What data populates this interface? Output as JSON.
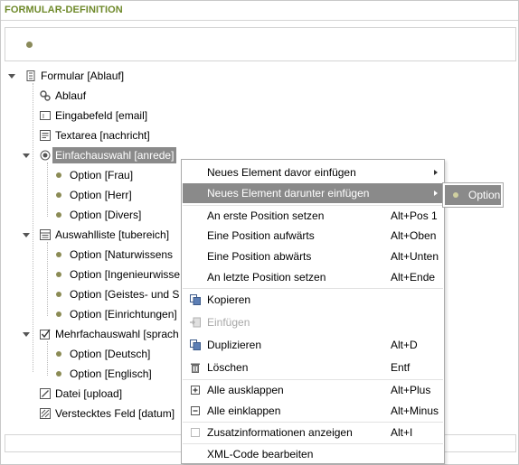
{
  "panel": {
    "title": "FORMULAR-DEFINITION"
  },
  "tree": {
    "root": "Formular [Ablauf]",
    "ablauf": "Ablauf",
    "eingabefeld": "Eingabefeld [email]",
    "textarea": "Textarea [nachricht]",
    "einfachauswahl": "Einfachauswahl [anrede]",
    "opt_frau": "Option [Frau]",
    "opt_herr": "Option [Herr]",
    "opt_divers": "Option [Divers]",
    "auswahlliste": "Auswahlliste [tubereich]",
    "opt_natur": "Option [Naturwissens",
    "opt_ing": "Option [Ingenieurwisse",
    "opt_geist": "Option [Geistes- und S",
    "opt_einr": "Option [Einrichtungen]",
    "mehrfach": "Mehrfachauswahl [sprach",
    "opt_deutsch": "Option [Deutsch]",
    "opt_englisch": "Option [Englisch]",
    "datei": "Datei [upload]",
    "versteckt": "Verstecktes Feld [datum]"
  },
  "context_menu": {
    "insert_before": "Neues Element davor einfügen",
    "insert_below": "Neues Element darunter einfügen",
    "first_pos": "An erste Position setzen",
    "first_pos_sc": "Alt+Pos 1",
    "up": "Eine Position aufwärts",
    "up_sc": "Alt+Oben",
    "down": "Eine Position abwärts",
    "down_sc": "Alt+Unten",
    "last_pos": "An letzte Position setzen",
    "last_pos_sc": "Alt+Ende",
    "copy": "Kopieren",
    "paste": "Einfügen",
    "duplicate": "Duplizieren",
    "duplicate_sc": "Alt+D",
    "delete": "Löschen",
    "delete_sc": "Entf",
    "expand_all": "Alle ausklappen",
    "expand_all_sc": "Alt+Plus",
    "collapse_all": "Alle einklappen",
    "collapse_all_sc": "Alt+Minus",
    "show_info": "Zusatzinformationen anzeigen",
    "show_info_sc": "Alt+I",
    "edit_xml": "XML-Code bearbeiten"
  },
  "submenu": {
    "option": "Option"
  },
  "colors": {
    "title": "#6f8a2b",
    "selection": "#8a8a8a",
    "bullet": "#8b8b55"
  }
}
